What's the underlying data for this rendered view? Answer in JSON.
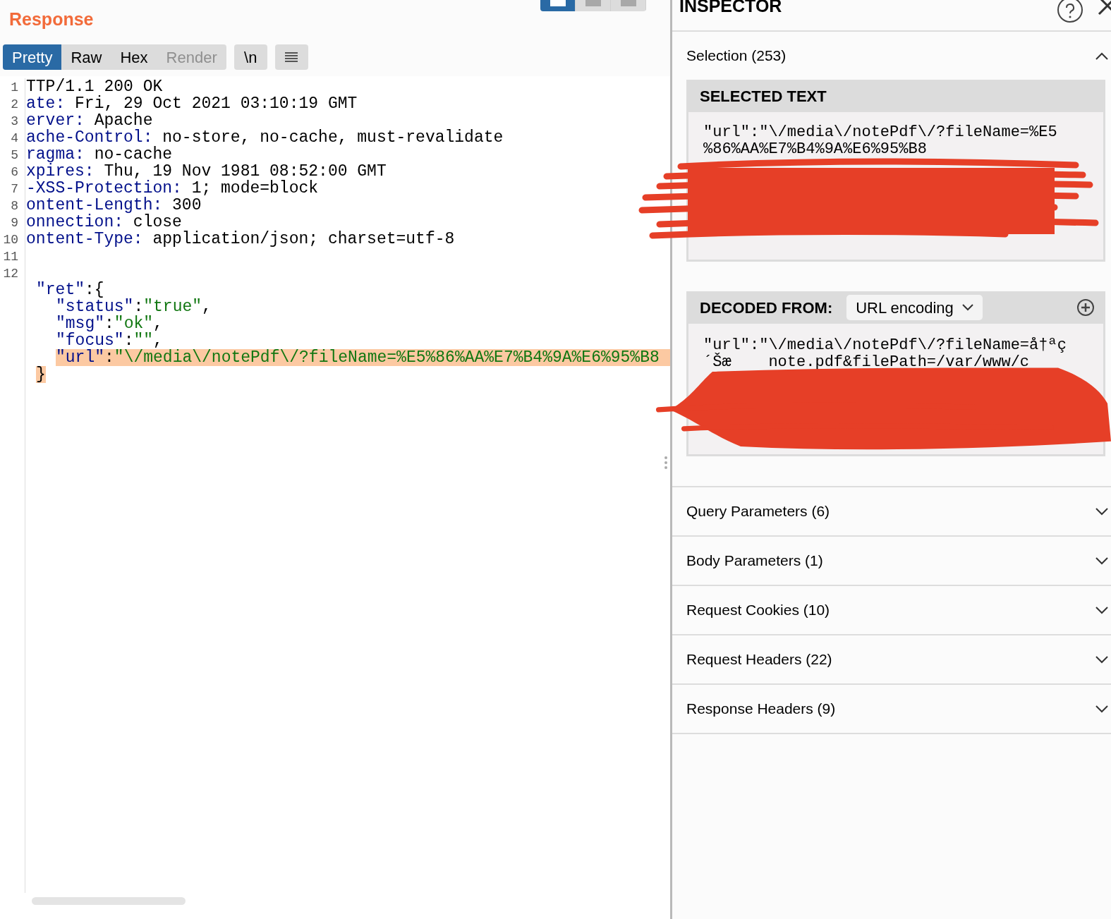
{
  "response": {
    "title": "Response",
    "view_buttons": [
      {
        "selected": true
      },
      {
        "selected": false
      },
      {
        "selected": false
      }
    ],
    "tabs": [
      {
        "label": "Pretty",
        "selected": true,
        "disabled": false
      },
      {
        "label": "Raw",
        "selected": false,
        "disabled": false
      },
      {
        "label": "Hex",
        "selected": false,
        "disabled": false
      },
      {
        "label": "Render",
        "selected": false,
        "disabled": true
      }
    ],
    "newline_toggle": "\\n",
    "header_lines": [
      {
        "number": "1",
        "value": "TTP/1.1 200 OK"
      },
      {
        "number": "2",
        "key": "ate:",
        "value": " Fri, 29 Oct 2021 03:10:19 GMT"
      },
      {
        "number": "3",
        "key": "erver:",
        "value": " Apache"
      },
      {
        "number": "4",
        "key": "ache-Control:",
        "value": " no-store, no-cache, must-revalidate"
      },
      {
        "number": "5",
        "key": "ragma:",
        "value": " no-cache"
      },
      {
        "number": "6",
        "key": "xpires:",
        "value": " Thu, 19 Nov 1981 08:52:00 GMT"
      },
      {
        "number": "7",
        "key": "-XSS-Protection:",
        "value": " 1; mode=block"
      },
      {
        "number": "8",
        "key": "ontent-Length:",
        "value": " 300"
      },
      {
        "number": "9",
        "key": "onnection:",
        "value": " close"
      },
      {
        "number": "10",
        "key": "ontent-Type:",
        "value": " application/json; charset=utf-8"
      },
      {
        "number": "11"
      },
      {
        "number": "12"
      }
    ],
    "body_lines": [
      {
        "tokens": [
          {
            "kind": "key",
            "text": "\"ret\"",
            "selected": false
          },
          {
            "kind": "plain",
            "text": ":{",
            "selected": false
          }
        ],
        "children": [
          {
            "tokens": [
              {
                "kind": "key",
                "text": "\"status\"",
                "selected": false
              },
              {
                "kind": "plain",
                "text": ":",
                "selected": false
              },
              {
                "kind": "string",
                "text": "\"true\"",
                "selected": false
              },
              {
                "kind": "plain",
                "text": ",",
                "selected": false
              }
            ]
          },
          {
            "tokens": [
              {
                "kind": "key",
                "text": "\"msg\"",
                "selected": false
              },
              {
                "kind": "plain",
                "text": ":",
                "selected": false
              },
              {
                "kind": "string",
                "text": "\"ok\"",
                "selected": false
              },
              {
                "kind": "plain",
                "text": ",",
                "selected": false
              }
            ]
          },
          {
            "tokens": [
              {
                "kind": "key",
                "text": "\"focus\"",
                "selected": false
              },
              {
                "kind": "plain",
                "text": ":",
                "selected": false
              },
              {
                "kind": "string",
                "text": "\"\"",
                "selected": false
              },
              {
                "kind": "plain",
                "text": ",",
                "selected": false
              }
            ]
          },
          {
            "tokens": [
              {
                "kind": "key",
                "text": "\"url\"",
                "selected": true
              },
              {
                "kind": "plain",
                "text": ":",
                "selected": true
              },
              {
                "kind": "string",
                "text": "\"\\/media\\/notePdf\\/?fileName=%E5%86%AA%E7%B4%9A%E6%95%B8",
                "selected": true
              }
            ]
          }
        ]
      },
      {
        "tokens": [
          {
            "kind": "plain",
            "text": "}",
            "selected": true
          }
        ]
      }
    ]
  },
  "inspector": {
    "title": "INSPECTOR",
    "selection": {
      "label": "Selection (253)",
      "expanded": true,
      "selected_text": {
        "title": "SELECTED TEXT",
        "lines": [
          "\"url\":\"\\/media\\/notePdf\\/?fileName=%E5",
          "%86%AA%E7%B4%9A%E6%95%B8"
        ]
      },
      "decoded": {
        "title": "DECODED FROM:",
        "encoding": "URL encoding",
        "lines": [
          "\"url\":\"\\/media\\/notePdf\\/?fileName=å†ªç",
          "´Šæ    note.pdf&filePath=/var/www/c"
        ]
      }
    },
    "sections": [
      {
        "label": "Query Parameters (6)",
        "expanded": false
      },
      {
        "label": "Body Parameters (1)",
        "expanded": false
      },
      {
        "label": "Request Cookies (10)",
        "expanded": false
      },
      {
        "label": "Request Headers (22)",
        "expanded": false
      },
      {
        "label": "Response Headers (9)",
        "expanded": false
      }
    ]
  }
}
